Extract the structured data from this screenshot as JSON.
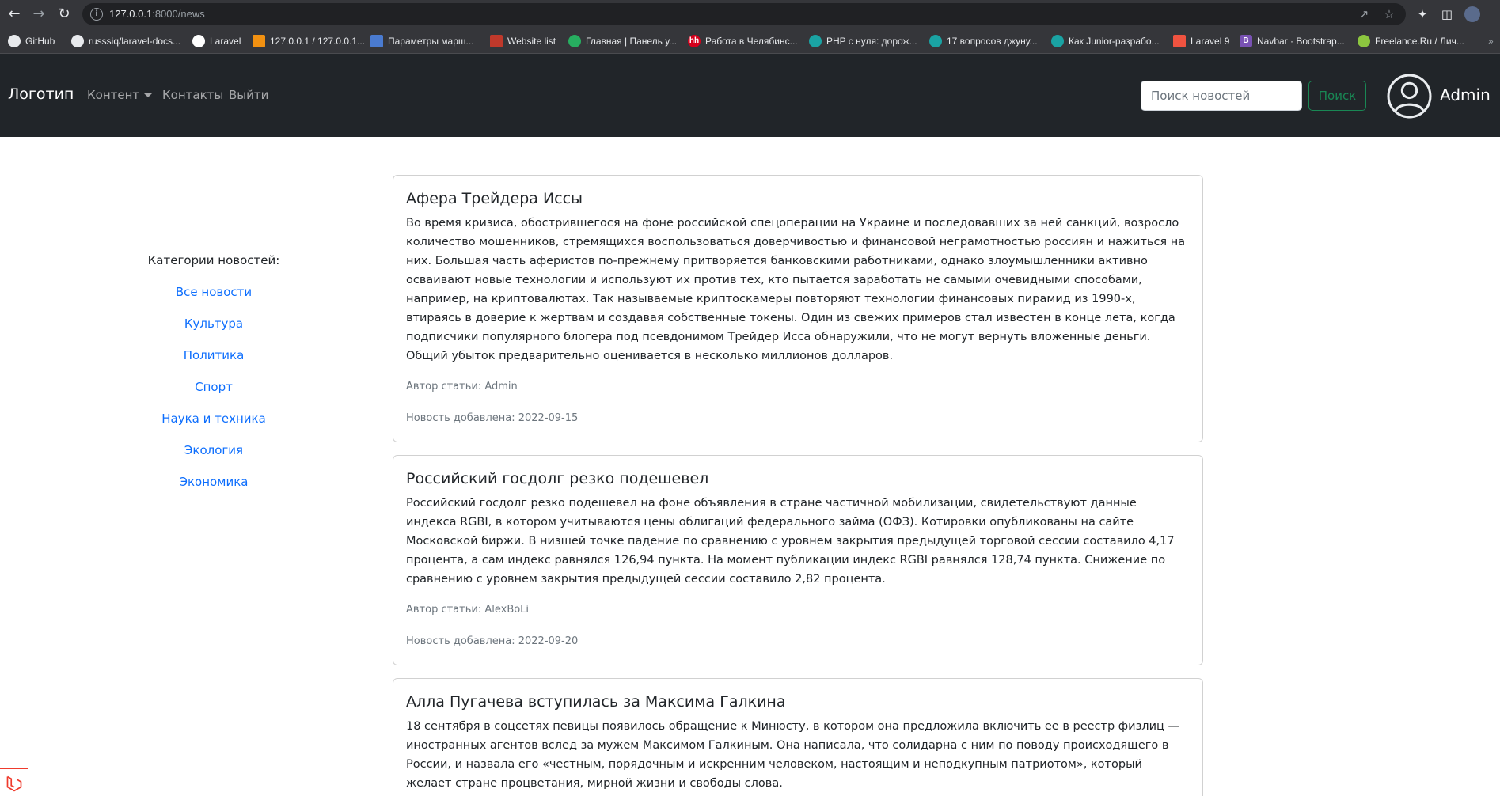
{
  "browser": {
    "url_host": "127.0.0.1",
    "url_rest": ":8000/news",
    "bookmarks": [
      {
        "label": "GitHub",
        "color": "#24292f"
      },
      {
        "label": "russsiq/laravel-docs...",
        "color": "#24292f"
      },
      {
        "label": "Laravel",
        "color": "#ffffff"
      },
      {
        "label": "127.0.0.1 / 127.0.0.1...",
        "color": "#f29111"
      },
      {
        "label": "Параметры марш...",
        "color": "#4a7bd0"
      },
      {
        "label": "Website list",
        "color": "#c0392b"
      },
      {
        "label": "Главная | Панель у...",
        "color": "#27ae60"
      },
      {
        "label": "Работа в Челябинс...",
        "color": "#d6001c"
      },
      {
        "label": "PHP с нуля: дорож...",
        "color": "#1aa3a3"
      },
      {
        "label": "17 вопросов джуну...",
        "color": "#1aa3a3"
      },
      {
        "label": "Как Junior-разрабо...",
        "color": "#1aa3a3"
      },
      {
        "label": "Laravel 9",
        "color": "#f05340"
      },
      {
        "label": "Navbar · Bootstrap...",
        "color": "#7952b3"
      },
      {
        "label": "Freelance.Ru / Лич...",
        "color": "#8cc63f"
      }
    ]
  },
  "navbar": {
    "brand": "Логотип",
    "links": [
      "Контент",
      "Контакты",
      "Выйти"
    ],
    "search_placeholder": "Поиск новостей",
    "search_button": "Поиск",
    "user_name": "Admin"
  },
  "sidebar": {
    "title": "Категории новостей:",
    "categories": [
      "Все новости",
      "Культура",
      "Политика",
      "Спорт",
      "Наука и техника",
      "Экология",
      "Экономика"
    ]
  },
  "news": [
    {
      "title": "Афера Трейдера Иссы",
      "text": "Во время кризиса, обострившегося на фоне российской спецоперации на Украине и последовавших за ней санкций, возросло количество мошенников, стремящихся воспользоваться доверчивостью и финансовой неграмотностью россиян и нажиться на них. Большая часть аферистов по-прежнему притворяется банковскими работниками, однако злоумышленники активно осваивают новые технологии и используют их против тех, кто пытается заработать не самыми очевидными способами, например, на криптовалютах. Так называемые криптоскамеры повторяют технологии финансовых пирамид из 1990-х, втираясь в доверие к жертвам и создавая собственные токены. Один из свежих примеров стал известен в конце лета, когда подписчики популярного блогера под псевдонимом Трейдер Исса обнаружили, что не могут вернуть вложенные деньги. Общий убыток предварительно оценивается в несколько миллионов долларов.",
      "author": "Автор статьи: Admin",
      "date": "Новость добавлена: 2022-09-15"
    },
    {
      "title": "Российский госдолг резко подешевел",
      "text": "Российский госдолг резко подешевел на фоне объявления в стране частичной мобилизации, свидетельствуют данные индекса RGBI, в котором учитываются цены облигаций федерального займа (ОФЗ). Котировки опубликованы на сайте Московской биржи. В низшей точке падение по сравнению с уровнем закрытия предыдущей торговой сессии составило 4,17 процента, а сам индекс равнялся 126,94 пункта. На момент публикации индекс RGBI равнялся 128,74 пункта. Снижение по сравнению с уровнем закрытия предыдущей сессии составило 2,82 процента.",
      "author": "Автор статьи: AlexBoLi",
      "date": "Новость добавлена: 2022-09-20"
    },
    {
      "title": "Алла Пугачева вступилась за Максима Галкина",
      "text": "18 сентября в соцсетях певицы появилось обращение к Минюсту, в котором она предложила включить ее в реестр физлиц — иностранных агентов вслед за мужем Максимом Галкиным. Она написала, что солидарна с ним по поводу происходящего в России, и назвала его «честным, порядочным и искренним человеком, настоящим и неподкупным патриотом», который желает стране процветания, мирной жизни и свободы слова."
    }
  ]
}
